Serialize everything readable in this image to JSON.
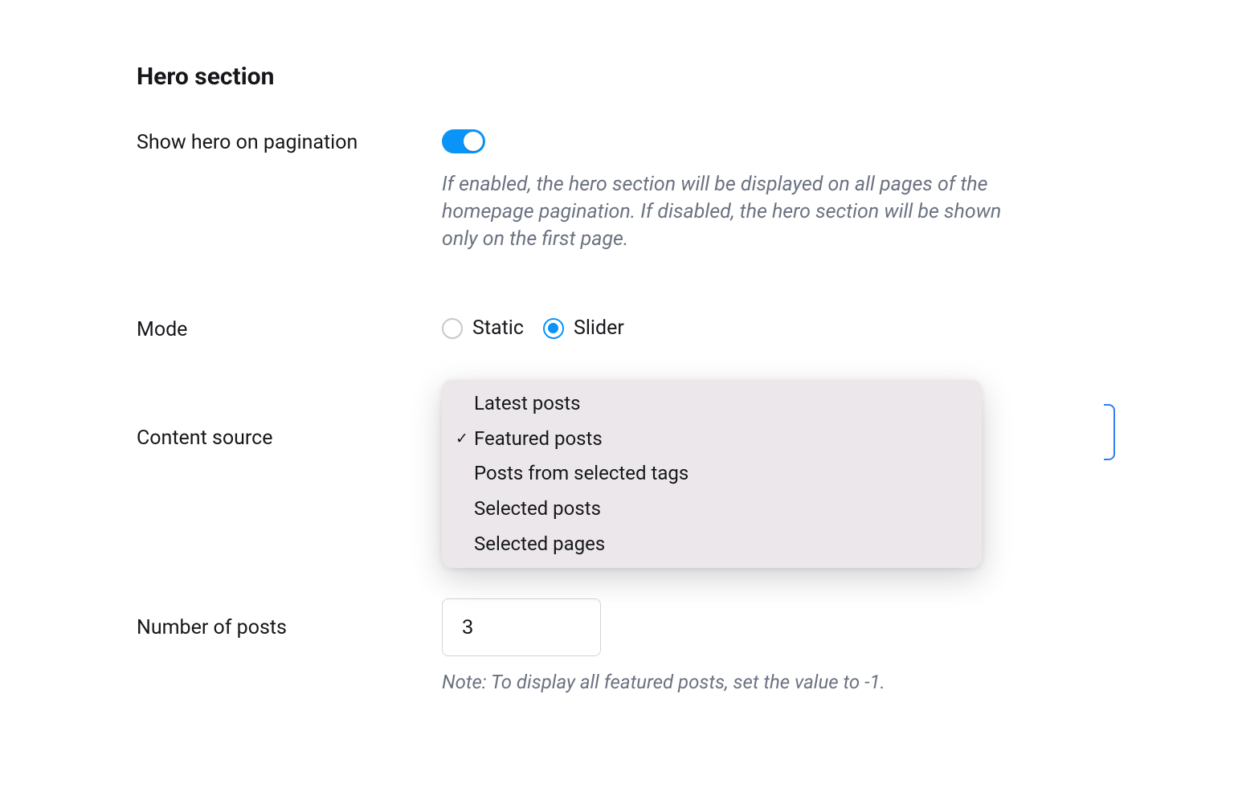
{
  "section": {
    "title": "Hero section"
  },
  "pagination": {
    "label": "Show hero on pagination",
    "enabled": true,
    "helper": "If enabled, the hero section will be displayed on all pages of the homepage pagination. If disabled, the hero section will be shown only on the first page."
  },
  "mode": {
    "label": "Mode",
    "options": [
      {
        "label": "Static",
        "selected": false
      },
      {
        "label": "Slider",
        "selected": true
      }
    ]
  },
  "content_source": {
    "label": "Content source",
    "options": [
      {
        "label": "Latest posts",
        "selected": false
      },
      {
        "label": "Featured posts",
        "selected": true
      },
      {
        "label": "Posts from selected tags",
        "selected": false
      },
      {
        "label": "Selected posts",
        "selected": false
      },
      {
        "label": "Selected pages",
        "selected": false
      }
    ]
  },
  "num_posts": {
    "label": "Number of posts",
    "value": "3",
    "note": "Note: To display all featured posts, set the value to -1."
  }
}
